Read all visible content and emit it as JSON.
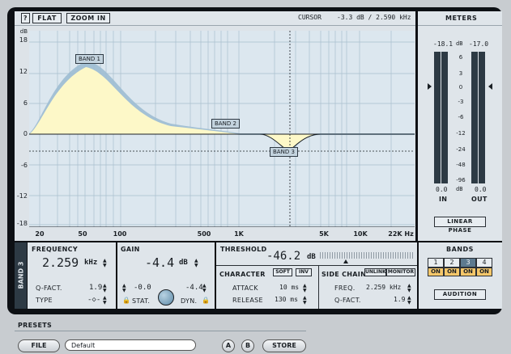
{
  "toolbar": {
    "help_label": "?",
    "flat_label": "FLAT",
    "zoom_label": "ZOOM IN",
    "cursor_label": "CURSOR",
    "cursor_value": "-3.3 dB / 2.590 kHz"
  },
  "graph": {
    "db_unit": "dB",
    "y_ticks": [
      "18",
      "12",
      "6",
      "0",
      "-6",
      "-12",
      "-18"
    ],
    "x_ticks": [
      "20",
      "50",
      "100",
      "500",
      "1K",
      "5K",
      "10K",
      "22K Hz"
    ],
    "bands": [
      {
        "label": "BAND 1"
      },
      {
        "label": "BAND 2"
      },
      {
        "label": "BAND 3"
      }
    ],
    "colors": {
      "curve_fill": "#fdf8c8",
      "band_band": "#8fb3cc",
      "grid": "#9fb6c6"
    }
  },
  "meters": {
    "title": "METERS",
    "in_peak": "-18.1",
    "out_peak": "-17.0",
    "db_unit": "dB",
    "scale": [
      "6",
      "3",
      "0",
      "-3",
      "-6",
      "-12",
      "-24",
      "-48",
      "-96"
    ],
    "in_value": "0.0",
    "out_value": "0.0",
    "in_label": "IN",
    "out_label": "OUT",
    "linear_phase_label": "LINEAR PHASE"
  },
  "band_tab": "BAND 3",
  "frequency": {
    "label": "FREQUENCY",
    "value": "2.259",
    "unit": "kHz",
    "qfact_label": "Q-FACT.",
    "qfact_value": "1.9",
    "type_label": "TYPE",
    "type_symbol": "-◇-"
  },
  "gain": {
    "label": "GAIN",
    "value": "-4.4",
    "unit": "dB",
    "stat_value": "-0.0",
    "dyn_value": "-4.4",
    "stat_label": "STAT.",
    "dyn_label": "DYN."
  },
  "threshold": {
    "label": "THRESHOLD",
    "value": "-46.2",
    "unit": "dB"
  },
  "character": {
    "label": "CHARACTER",
    "soft_label": "SOFT",
    "inv_label": "INV",
    "attack_label": "ATTACK",
    "attack_value": "10 ms",
    "release_label": "RELEASE",
    "release_value": "130 ms"
  },
  "sidechain": {
    "label": "SIDE CHAIN",
    "unlink_label": "UNLINK",
    "monitor_label": "MONITOR",
    "freq_label": "FREQ.",
    "freq_value": "2.259 kHz",
    "qfact_label": "Q-FACT.",
    "qfact_value": "1.9"
  },
  "bands_panel": {
    "title": "BANDS",
    "numbers": [
      "1",
      "2",
      "3",
      "4"
    ],
    "on_label": "ON",
    "audition_label": "AUDITION"
  },
  "presets": {
    "title": "PRESETS",
    "file_label": "FILE",
    "preset_name": "Default",
    "a_label": "A",
    "b_label": "B",
    "store_label": "STORE"
  }
}
